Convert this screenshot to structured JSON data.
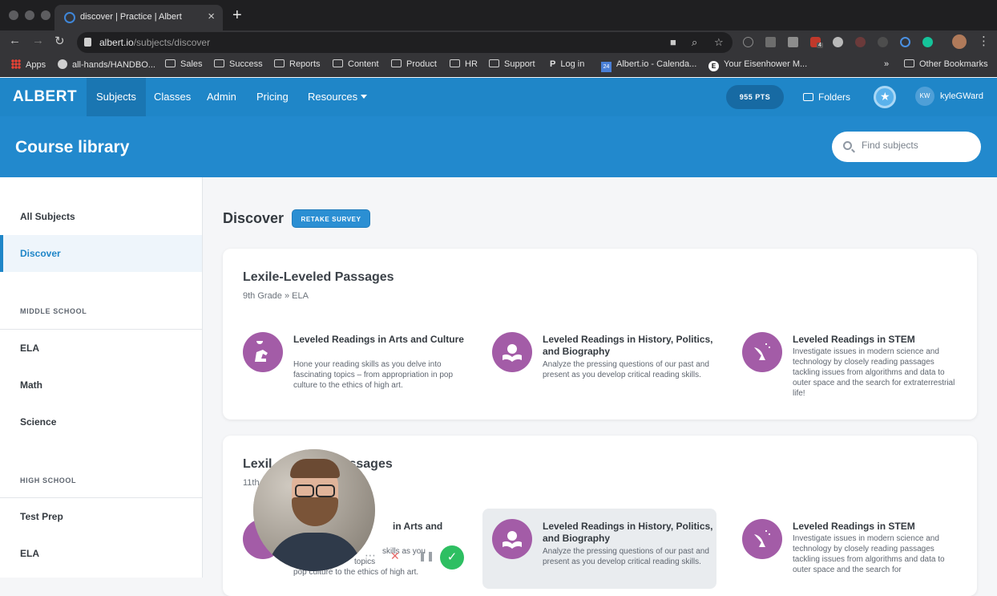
{
  "browser": {
    "tab_title": "discover | Practice | Albert",
    "url_host": "albert.io",
    "url_path": "/subjects/discover",
    "bookmarks": [
      "Apps",
      "all-hands/HANDBO...",
      "Sales",
      "Success",
      "Reports",
      "Content",
      "Product",
      "HR",
      "Support",
      "Log in",
      "Albert.io - Calenda...",
      "Your Eisenhower M..."
    ],
    "bookmarks_overflow": "»",
    "other_bookmarks": "Other Bookmarks",
    "calendar_badge": "24",
    "ext_badge": "4"
  },
  "app": {
    "logo": "ALBERT",
    "nav": [
      "Subjects",
      "Classes",
      "Admin",
      "Pricing",
      "Resources"
    ],
    "points": "955 PTS",
    "folders": "Folders",
    "avatar_initials": "KW",
    "username": "kyleGWard"
  },
  "hero": {
    "title": "Course library",
    "search_placeholder": "Find subjects"
  },
  "sidebar": {
    "all_subjects": "All Subjects",
    "discover": "Discover",
    "middle_school_heading": "MIDDLE SCHOOL",
    "middle_school_items": [
      "ELA",
      "Math",
      "Science"
    ],
    "high_school_heading": "HIGH SCHOOL",
    "high_school_items": [
      "Test Prep",
      "ELA"
    ]
  },
  "main": {
    "title": "Discover",
    "retake_button": "RETAKE SURVEY",
    "cards": [
      {
        "title": "Lexile-Leveled Passages",
        "subtitle": "9th Grade » ELA",
        "courses": [
          {
            "name": "Leveled Readings in Arts and Culture",
            "description": "Hone your reading skills as you delve into fascinating topics – from appropriation in pop culture to the ethics of high art.",
            "icon": "thinker-statue-icon"
          },
          {
            "name": "Leveled Readings in History, Politics, and Biography",
            "description": "Analyze the pressing questions of our past and present as you develop critical reading skills.",
            "icon": "globe-book-icon"
          },
          {
            "name": "Leveled Readings in STEM",
            "description": "Investigate issues in modern science and technology by closely reading passages tackling issues from algorithms and data to outer space and the search for extraterrestrial life!",
            "icon": "satellite-dish-icon"
          }
        ]
      },
      {
        "title_visible_start": "Lexil",
        "title_visible_end": "ssages",
        "subtitle_visible": "11th",
        "courses": [
          {
            "name_visible": "in Arts and",
            "description_visible_1": "skills as you",
            "description_visible_2": "topics",
            "description_visible_3": "pop culture to the ethics of high art."
          },
          {
            "name": "Leveled Readings in History, Politics, and Biography",
            "description": "Analyze the pressing questions of our past and present as you develop critical reading skills."
          },
          {
            "name": "Leveled Readings in STEM",
            "description": "Investigate issues in modern science and technology by closely reading passages tackling issues from algorithms and data to outer space and the search for"
          }
        ]
      }
    ]
  },
  "colors": {
    "brand_blue": "#1f86c8",
    "course_purple": "#a35ca7",
    "confirm_green": "#2ebf62"
  },
  "overlay": {
    "more": "⋯",
    "cancel": "✕",
    "pause": "❚❚",
    "confirm": "✓"
  }
}
